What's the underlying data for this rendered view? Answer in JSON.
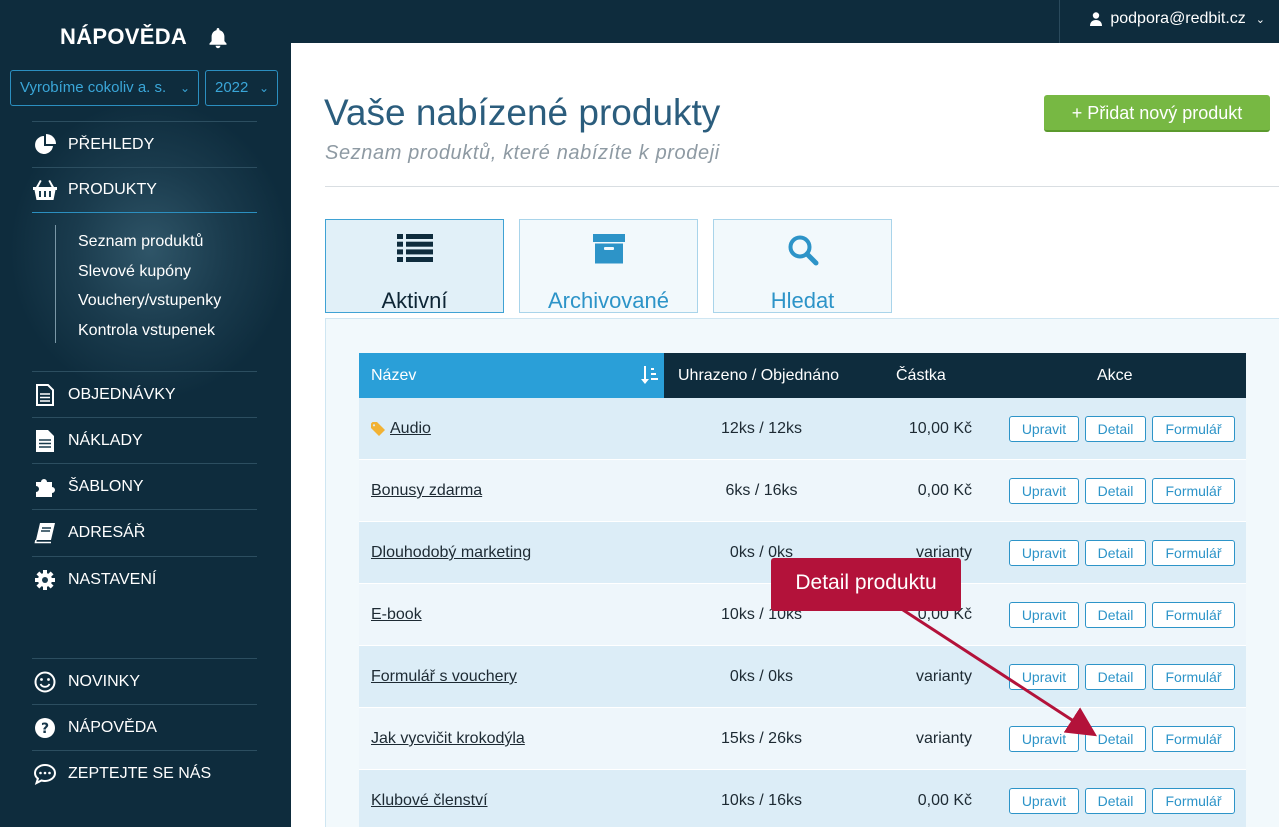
{
  "sidebar": {
    "brand": "NÁPOVĚDA",
    "company_select": "Vyrobíme cokoliv a. s.",
    "year_select": "2022",
    "nav": {
      "prehledy": "PŘEHLEDY",
      "produkty": "PRODUKTY",
      "objednavky": "OBJEDNÁVKY",
      "naklady": "NÁKLADY",
      "sablony": "ŠABLONY",
      "adresar": "ADRESÁŘ",
      "nastaveni": "NASTAVENÍ",
      "novinky": "NOVINKY",
      "napoveda": "NÁPOVĚDA",
      "zeptejte": "ZEPTEJTE SE NÁS"
    },
    "sub": [
      "Seznam produktů",
      "Slevové kupóny",
      "Vouchery/vstupenky",
      "Kontrola vstupenek"
    ]
  },
  "topbar": {
    "user": "podpora@redbit.cz"
  },
  "header": {
    "title": "Vaše nabízené produkty",
    "subtitle": "Seznam produktů, které nabízíte k prodeji",
    "add_button": "+ Přidat nový produkt"
  },
  "tabs": {
    "active": "Aktivní",
    "archived": "Archivované",
    "search": "Hledat"
  },
  "table": {
    "headers": {
      "name": "Název",
      "paid": "Uhrazeno / Objednáno",
      "amount": "Částka",
      "actions": "Akce"
    },
    "buttons": {
      "edit": "Upravit",
      "detail": "Detail",
      "form": "Formulář"
    },
    "rows": [
      {
        "name": "Audio",
        "paid": "12ks / 12ks",
        "amount": "10,00 Kč"
      },
      {
        "name": "Bonusy zdarma",
        "paid": "6ks / 16ks",
        "amount": "0,00 Kč"
      },
      {
        "name": "Dlouhodobý marketing",
        "paid": "0ks / 0ks",
        "amount": "varianty"
      },
      {
        "name": "E-book",
        "paid": "10ks / 10ks",
        "amount": "0,00 Kč"
      },
      {
        "name": "Formulář s vouchery",
        "paid": "0ks / 0ks",
        "amount": "varianty"
      },
      {
        "name": "Jak vycvičit krokodýla",
        "paid": "15ks / 26ks",
        "amount": "varianty"
      },
      {
        "name": "Klubové členství",
        "paid": "10ks / 16ks",
        "amount": "0,00 Kč"
      }
    ]
  },
  "callout": {
    "text": "Detail produktu"
  },
  "colors": {
    "sidebar": "#0e2c3d",
    "accent": "#2a9fd8",
    "green": "#77b843",
    "callout": "#b3123a"
  }
}
